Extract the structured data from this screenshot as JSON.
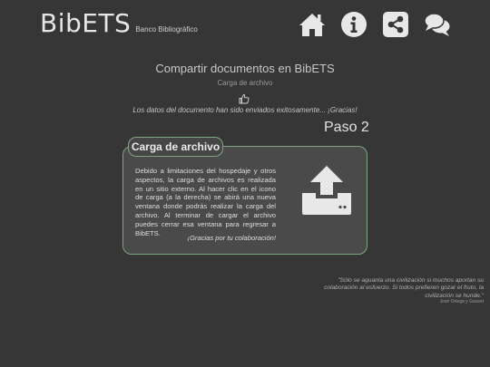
{
  "header": {
    "logo_text": "BibETS",
    "logo_subtitle": "Banco Bibliográfico",
    "nav": [
      {
        "icon": "home-icon"
      },
      {
        "icon": "info-icon"
      },
      {
        "icon": "share-icon"
      },
      {
        "icon": "chat-icon"
      }
    ]
  },
  "main": {
    "title": "Compartir documentos en BibETS",
    "subtitle": "Carga de archivo",
    "success_message": "Los datos del documento han sido enviados exitosamente... ¡Gracias!",
    "step_label": "Paso 2"
  },
  "card": {
    "title": "Carga de archivo",
    "body": "Debido a limitaciones del hospedaje y otros aspectos, la carga de archivos es realizada en un sitio externo. Al hacer clic en el icono de carga (a la derecha) se abirá una nueva ventana donde podrás realizar la carga del archivo. Al terminar de cargar el archivo puedes cerrar esa ventana para regresar a BibETS.",
    "thanks": "¡Gracias por tu colaboración!",
    "upload_icon": "upload-icon"
  },
  "footer": {
    "quote": "\"Sólo se aguanta una civilización si muchos aportan su colaboración al esfuerzo. Si todos prefieren gozar el fruto, la civilización se hunde.\"",
    "author": "José Ortega y Gasset"
  },
  "colors": {
    "background": "#363636",
    "card_border": "#7ea67e",
    "card_background": "#4a4a4a",
    "icon": "#e8e8e8"
  }
}
